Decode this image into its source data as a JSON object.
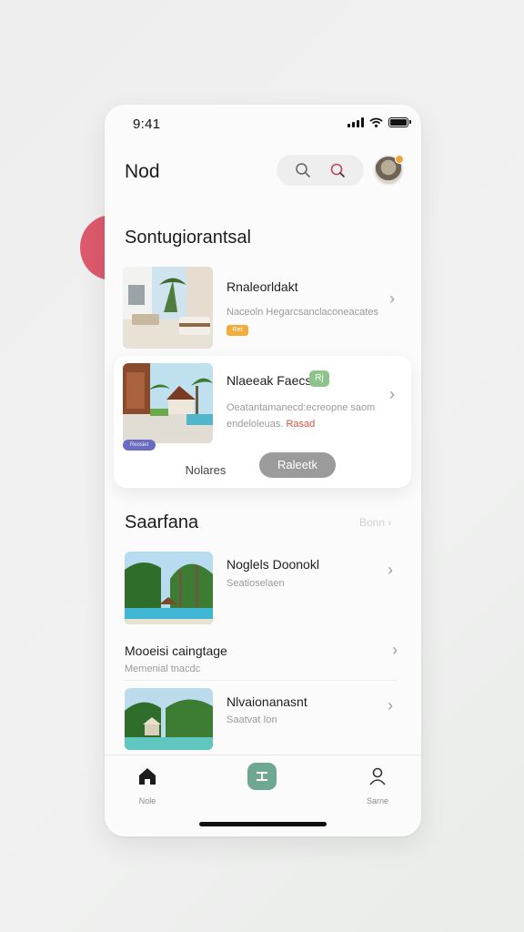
{
  "status_bar": {
    "time": "9:41"
  },
  "header": {
    "title": "Nod"
  },
  "sections": {
    "first": {
      "title": "Sontugiorantsal"
    },
    "second": {
      "title": "Saarfana",
      "see_all": "Bonn"
    }
  },
  "listings": [
    {
      "title": "Rnaleorldakt",
      "subtitle": "Naceoln Hegarcsanclaconeacates",
      "badge": "Ret"
    },
    {
      "title": "Nlaeeak Faecs",
      "subtitle_line1": "Oeatantamanecd:ecreopne saom",
      "subtitle_line2": "endeloleuas.",
      "highlight": "Rasad",
      "badge": "Rj",
      "tag": "Reosiet"
    }
  ],
  "actions": {
    "secondary": "Nolares",
    "primary": "Raleetk"
  },
  "recent": [
    {
      "title": "Noglels Doonokl",
      "subtitle": "Seatioselaen"
    },
    {
      "title": "Mooeisi caingtage",
      "subtitle": "Memenial tnacdc"
    },
    {
      "title": "Nlvaionanasnt",
      "subtitle": "Saatvat Ion"
    }
  ],
  "tabbar": {
    "home": "Nole",
    "profile": "Sarne"
  },
  "colors": {
    "accent": "#6fa892",
    "badge_orange": "#f2ac3c",
    "badge_green": "#8dc48a",
    "highlight_red": "#d9523f",
    "blob": "#dd5a6c"
  }
}
